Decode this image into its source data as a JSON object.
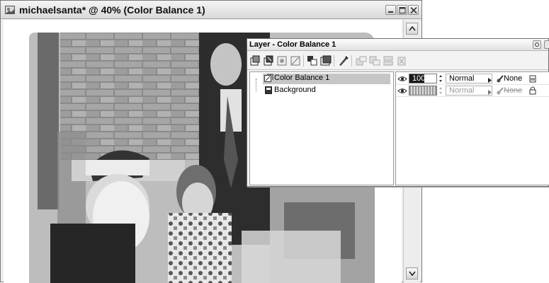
{
  "document_window": {
    "title": "michaelsanta* @ 40% (Color Balance 1)"
  },
  "layer_palette": {
    "title": "Layer - Color Balance 1",
    "layers": [
      {
        "name": "Color Balance 1",
        "opacity": "100",
        "blend_mode": "Normal",
        "mask": "None",
        "selected": true,
        "visible": true
      },
      {
        "name": "Background",
        "opacity": "",
        "blend_mode": "Normal",
        "mask": "None",
        "selected": false,
        "visible": true
      }
    ]
  },
  "colors": {
    "selection_row": "#c6c6c6",
    "panel_bg": "#f3f3f3",
    "title_text": "#111111"
  }
}
